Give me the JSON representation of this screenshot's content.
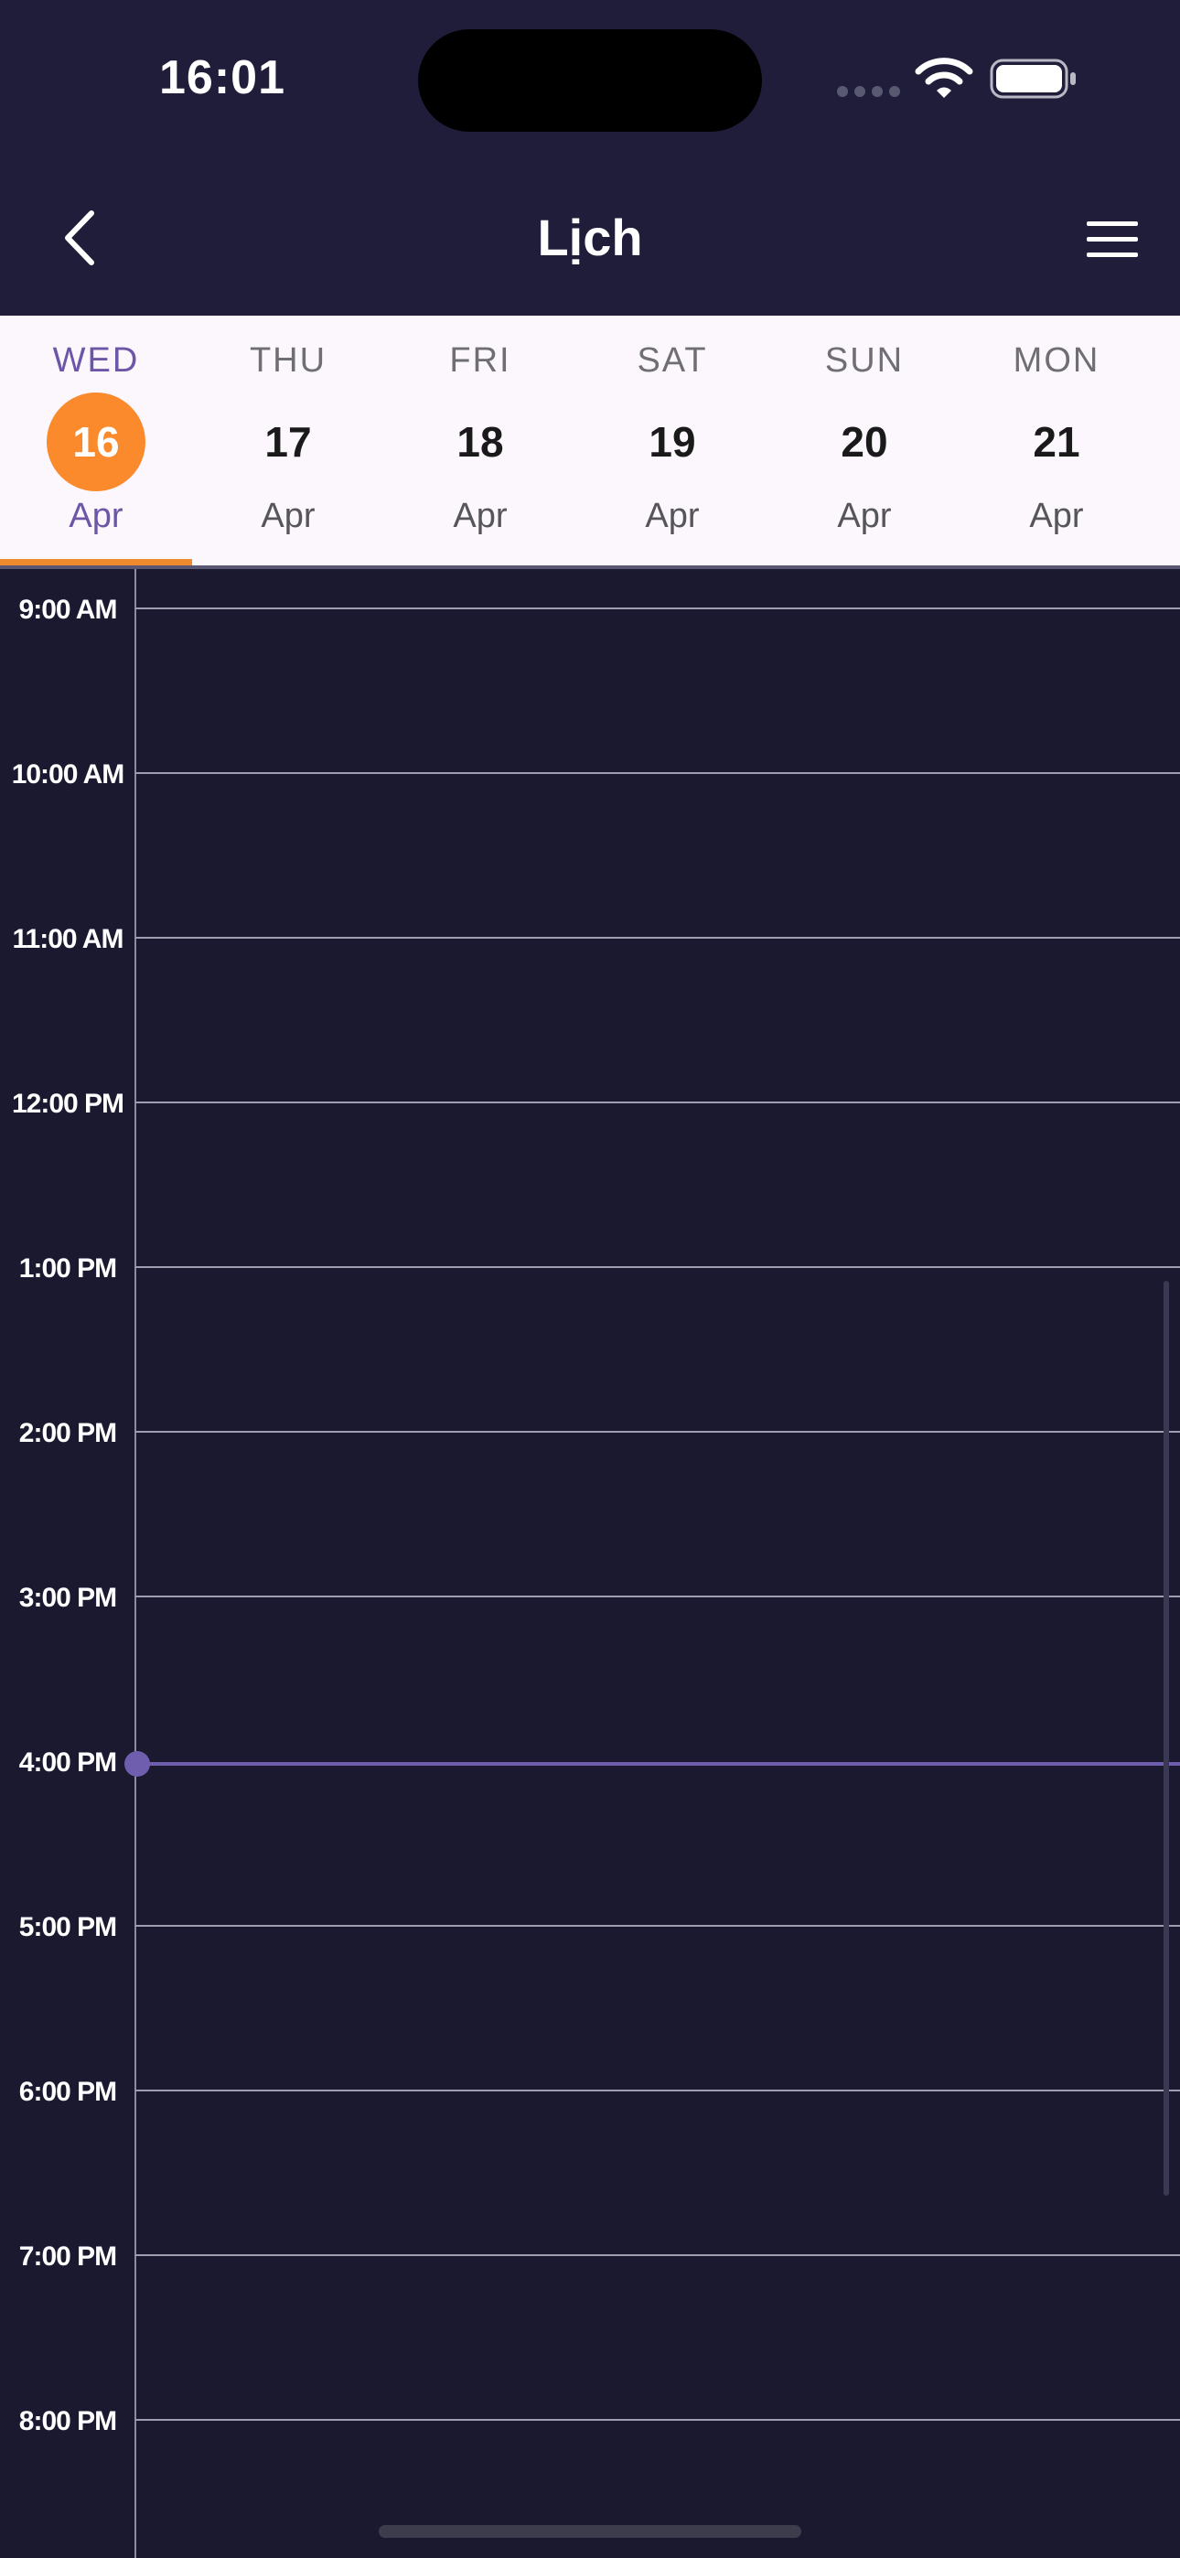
{
  "status_bar": {
    "time": "16:01"
  },
  "header": {
    "title": "Lịch"
  },
  "week": {
    "days": [
      {
        "dow": "WED",
        "day": "16",
        "month": "Apr",
        "selected": true
      },
      {
        "dow": "THU",
        "day": "17",
        "month": "Apr"
      },
      {
        "dow": "FRI",
        "day": "18",
        "month": "Apr"
      },
      {
        "dow": "SAT",
        "day": "19",
        "month": "Apr"
      },
      {
        "dow": "SUN",
        "day": "20",
        "month": "Apr"
      },
      {
        "dow": "MON",
        "day": "21",
        "month": "Apr"
      }
    ]
  },
  "timeline": {
    "hours": [
      "9:00 AM",
      "10:00 AM",
      "11:00 AM",
      "12:00 PM",
      "1:00 PM",
      "2:00 PM",
      "3:00 PM",
      "4:00 PM",
      "5:00 PM",
      "6:00 PM",
      "7:00 PM",
      "8:00 PM"
    ],
    "current_time_hour": "4:00 PM"
  },
  "colors": {
    "background": "#1a1930",
    "header": "#1f1d3a",
    "accent_orange": "#fa8a2c",
    "accent_purple": "#6f5dad"
  }
}
